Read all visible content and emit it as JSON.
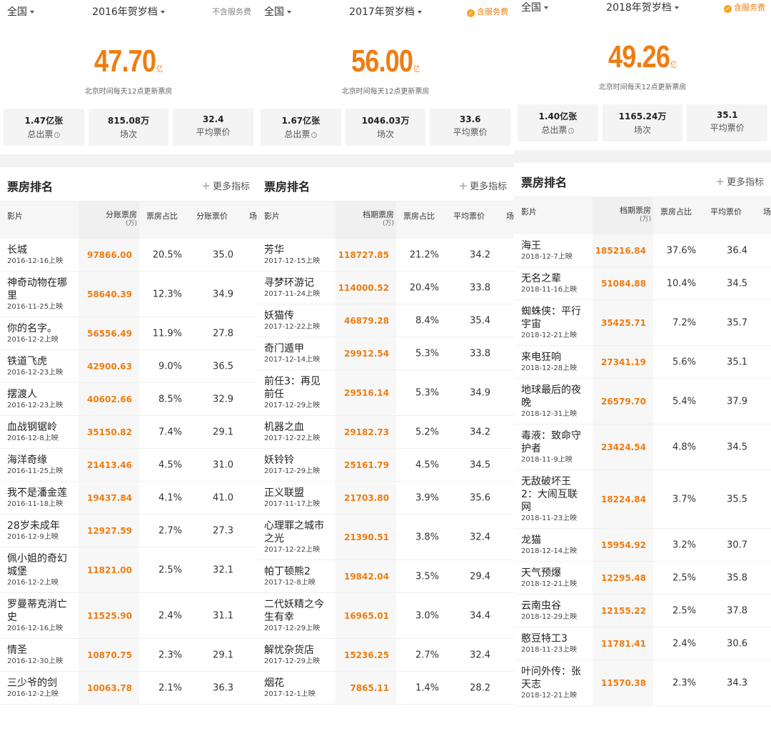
{
  "panels": [
    {
      "region": "全国",
      "season": "2016年贺岁档",
      "fee": "不含服务费",
      "fee_on": false,
      "total": "47.70",
      "total_unit": "亿",
      "note": "北京时间每天12点更新票房",
      "stats": [
        {
          "value": "1.47亿张",
          "label": "总出票"
        },
        {
          "value": "815.08万",
          "label": "场次"
        },
        {
          "value": "32.4",
          "label": "平均票价"
        }
      ],
      "section_title": "票房排名",
      "more": "更多指标",
      "columns": {
        "film": "影片",
        "box": "分账票房",
        "box_unit": "(万)",
        "share": "票房占比",
        "price": "分账票价",
        "cut": "场"
      },
      "rows": [
        {
          "name": "长城",
          "date": "2016-12-16上映",
          "box": "97866.00",
          "share": "20.5%",
          "price": "35.0"
        },
        {
          "name": "神奇动物在哪里",
          "date": "2016-11-25上映",
          "box": "58640.39",
          "share": "12.3%",
          "price": "34.9"
        },
        {
          "name": "你的名字。",
          "date": "2016-12-2上映",
          "box": "56556.49",
          "share": "11.9%",
          "price": "27.8"
        },
        {
          "name": "铁道飞虎",
          "date": "2016-12-23上映",
          "box": "42900.63",
          "share": "9.0%",
          "price": "36.5"
        },
        {
          "name": "摆渡人",
          "date": "2016-12-23上映",
          "box": "40602.66",
          "share": "8.5%",
          "price": "32.9"
        },
        {
          "name": "血战钢锯岭",
          "date": "2016-12-8上映",
          "box": "35150.82",
          "share": "7.4%",
          "price": "29.1"
        },
        {
          "name": "海洋奇缘",
          "date": "2016-11-25上映",
          "box": "21413.46",
          "share": "4.5%",
          "price": "31.0"
        },
        {
          "name": "我不是潘金莲",
          "date": "2016-11-18上映",
          "box": "19437.84",
          "share": "4.1%",
          "price": "41.0"
        },
        {
          "name": "28岁未成年",
          "date": "2016-12-9上映",
          "box": "12927.59",
          "share": "2.7%",
          "price": "27.3"
        },
        {
          "name": "佩小姐的奇幻城堡",
          "date": "2016-12-2上映",
          "box": "11821.00",
          "share": "2.5%",
          "price": "32.1"
        },
        {
          "name": "罗曼蒂克消亡史",
          "date": "2016-12-16上映",
          "box": "11525.90",
          "share": "2.4%",
          "price": "31.1"
        },
        {
          "name": "情圣",
          "date": "2016-12-30上映",
          "box": "10870.75",
          "share": "2.3%",
          "price": "29.1"
        },
        {
          "name": "三少爷的剑",
          "date": "2016-12-2上映",
          "box": "10063.78",
          "share": "2.1%",
          "price": "36.3"
        }
      ]
    },
    {
      "region": "全国",
      "season": "2017年贺岁档",
      "fee": "含服务费",
      "fee_on": true,
      "total": "56.00",
      "total_unit": "亿",
      "note": "北京时间每天12点更新票房",
      "stats": [
        {
          "value": "1.67亿张",
          "label": "总出票"
        },
        {
          "value": "1046.03万",
          "label": "场次"
        },
        {
          "value": "33.6",
          "label": "平均票价"
        }
      ],
      "section_title": "票房排名",
      "more": "更多指标",
      "columns": {
        "film": "影片",
        "box": "档期票房",
        "box_unit": "(万)",
        "share": "票房占比",
        "price": "平均票价",
        "cut": "场"
      },
      "rows": [
        {
          "name": "芳华",
          "date": "2017-12-15上映",
          "box": "118727.85",
          "share": "21.2%",
          "price": "34.2"
        },
        {
          "name": "寻梦环游记",
          "date": "2017-11-24上映",
          "box": "114000.52",
          "share": "20.4%",
          "price": "33.8"
        },
        {
          "name": "妖猫传",
          "date": "2017-12-22上映",
          "box": "46879.28",
          "share": "8.4%",
          "price": "35.4"
        },
        {
          "name": "奇门遁甲",
          "date": "2017-12-14上映",
          "box": "29912.54",
          "share": "5.3%",
          "price": "33.8"
        },
        {
          "name": "前任3：再见前任",
          "date": "2017-12-29上映",
          "box": "29516.14",
          "share": "5.3%",
          "price": "34.9"
        },
        {
          "name": "机器之血",
          "date": "2017-12-22上映",
          "box": "29182.73",
          "share": "5.2%",
          "price": "34.2"
        },
        {
          "name": "妖铃铃",
          "date": "2017-12-29上映",
          "box": "25161.79",
          "share": "4.5%",
          "price": "34.5"
        },
        {
          "name": "正义联盟",
          "date": "2017-11-17上映",
          "box": "21703.80",
          "share": "3.9%",
          "price": "35.6"
        },
        {
          "name": "心理罪之城市之光",
          "date": "2017-12-22上映",
          "box": "21390.51",
          "share": "3.8%",
          "price": "32.4"
        },
        {
          "name": "帕丁顿熊2",
          "date": "2017-12-8上映",
          "box": "19842.04",
          "share": "3.5%",
          "price": "29.4"
        },
        {
          "name": "二代妖精之今生有幸",
          "date": "2017-12-29上映",
          "box": "16965.01",
          "share": "3.0%",
          "price": "34.4"
        },
        {
          "name": "解忧杂货店",
          "date": "2017-12-29上映",
          "box": "15236.25",
          "share": "2.7%",
          "price": "32.4"
        },
        {
          "name": "烟花",
          "date": "2017-12-1上映",
          "box": "7865.11",
          "share": "1.4%",
          "price": "28.2"
        }
      ]
    },
    {
      "region": "全国",
      "season": "2018年贺岁档",
      "fee": "含服务费",
      "fee_on": true,
      "total": "49.26",
      "total_unit": "亿",
      "note": "北京时间每天12点更新票房",
      "stats": [
        {
          "value": "1.40亿张",
          "label": "总出票"
        },
        {
          "value": "1165.24万",
          "label": "场次"
        },
        {
          "value": "35.1",
          "label": "平均票价"
        }
      ],
      "section_title": "票房排名",
      "more": "更多指标",
      "columns": {
        "film": "影片",
        "box": "档期票房",
        "box_unit": "(万)",
        "share": "票房占比",
        "price": "平均票价",
        "cut": "场"
      },
      "rows": [
        {
          "name": "海王",
          "date": "2018-12-7上映",
          "box": "185216.84",
          "share": "37.6%",
          "price": "36.4"
        },
        {
          "name": "无名之辈",
          "date": "2018-11-16上映",
          "box": "51084.88",
          "share": "10.4%",
          "price": "34.5"
        },
        {
          "name": "蜘蛛侠：平行宇宙",
          "date": "2018-12-21上映",
          "box": "35425.71",
          "share": "7.2%",
          "price": "35.7"
        },
        {
          "name": "来电狂响",
          "date": "2018-12-28上映",
          "box": "27341.19",
          "share": "5.6%",
          "price": "35.1"
        },
        {
          "name": "地球最后的夜晚",
          "date": "2018-12-31上映",
          "box": "26579.70",
          "share": "5.4%",
          "price": "37.9"
        },
        {
          "name": "毒液：致命守护者",
          "date": "2018-11-9上映",
          "box": "23424.54",
          "share": "4.8%",
          "price": "34.5"
        },
        {
          "name": "无敌破坏王2：大闹互联网",
          "date": "2018-11-23上映",
          "box": "18224.84",
          "share": "3.7%",
          "price": "35.5"
        },
        {
          "name": "龙猫",
          "date": "2018-12-14上映",
          "box": "15954.92",
          "share": "3.2%",
          "price": "30.7"
        },
        {
          "name": "天气预爆",
          "date": "2018-12-21上映",
          "box": "12295.48",
          "share": "2.5%",
          "price": "35.8"
        },
        {
          "name": "云南虫谷",
          "date": "2018-12-29上映",
          "box": "12155.22",
          "share": "2.5%",
          "price": "37.8"
        },
        {
          "name": "憨豆特工3",
          "date": "2018-11-23上映",
          "box": "11781.41",
          "share": "2.4%",
          "price": "30.6"
        },
        {
          "name": "叶问外传：张天志",
          "date": "2018-12-21上映",
          "box": "11570.38",
          "share": "2.3%",
          "price": "34.3"
        }
      ]
    }
  ]
}
